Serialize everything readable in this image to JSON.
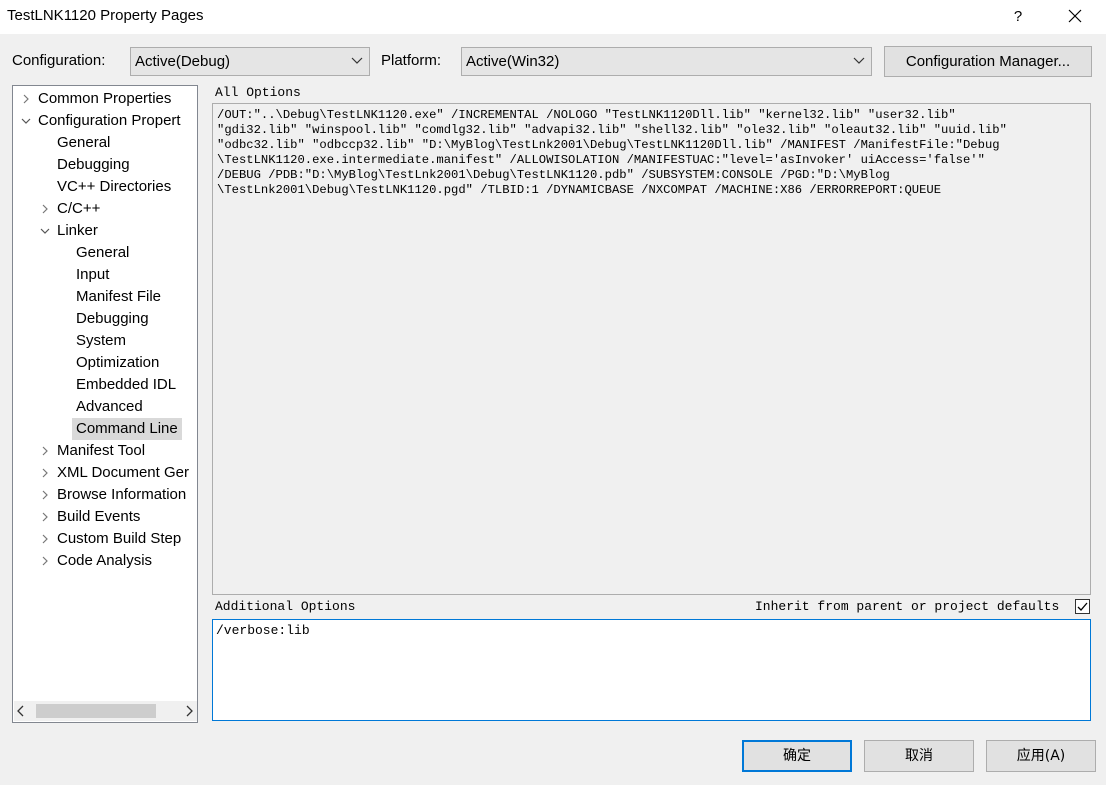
{
  "window": {
    "title": "TestLNK1120 Property Pages",
    "help_glyph": "?"
  },
  "config_bar": {
    "configuration_label": "Configuration:",
    "configuration_value": "Active(Debug)",
    "platform_label": "Platform:",
    "platform_value": "Active(Win32)",
    "manager_button": "Configuration Manager..."
  },
  "tree": {
    "items": [
      {
        "label": "Common Properties",
        "level": 0,
        "expander": "collapsed"
      },
      {
        "label": "Configuration Propert",
        "level": 0,
        "expander": "expanded"
      },
      {
        "label": "General",
        "level": 1,
        "expander": "none"
      },
      {
        "label": "Debugging",
        "level": 1,
        "expander": "none"
      },
      {
        "label": "VC++ Directories",
        "level": 1,
        "expander": "none"
      },
      {
        "label": "C/C++",
        "level": 1,
        "expander": "collapsed"
      },
      {
        "label": "Linker",
        "level": 1,
        "expander": "expanded"
      },
      {
        "label": "General",
        "level": 2,
        "expander": "none"
      },
      {
        "label": "Input",
        "level": 2,
        "expander": "none"
      },
      {
        "label": "Manifest File",
        "level": 2,
        "expander": "none"
      },
      {
        "label": "Debugging",
        "level": 2,
        "expander": "none"
      },
      {
        "label": "System",
        "level": 2,
        "expander": "none"
      },
      {
        "label": "Optimization",
        "level": 2,
        "expander": "none"
      },
      {
        "label": "Embedded IDL",
        "level": 2,
        "expander": "none"
      },
      {
        "label": "Advanced",
        "level": 2,
        "expander": "none"
      },
      {
        "label": "Command Line",
        "level": 2,
        "expander": "none",
        "selected": true
      },
      {
        "label": "Manifest Tool",
        "level": 1,
        "expander": "collapsed"
      },
      {
        "label": "XML Document Ger",
        "level": 1,
        "expander": "collapsed"
      },
      {
        "label": "Browse Information",
        "level": 1,
        "expander": "collapsed"
      },
      {
        "label": "Build Events",
        "level": 1,
        "expander": "collapsed"
      },
      {
        "label": "Custom Build Step",
        "level": 1,
        "expander": "collapsed"
      },
      {
        "label": "Code Analysis",
        "level": 1,
        "expander": "collapsed"
      }
    ]
  },
  "all_options": {
    "label": "All Options",
    "lines": [
      "/OUT:\"..\\Debug\\TestLNK1120.exe\" /INCREMENTAL /NOLOGO \"TestLNK1120Dll.lib\" \"kernel32.lib\" \"user32.lib\"",
      "\"gdi32.lib\" \"winspool.lib\" \"comdlg32.lib\" \"advapi32.lib\" \"shell32.lib\" \"ole32.lib\" \"oleaut32.lib\" \"uuid.lib\"",
      "\"odbc32.lib\" \"odbccp32.lib\" \"D:\\MyBlog\\TestLnk2001\\Debug\\TestLNK1120Dll.lib\" /MANIFEST /ManifestFile:\"Debug",
      "\\TestLNK1120.exe.intermediate.manifest\" /ALLOWISOLATION /MANIFESTUAC:\"level='asInvoker' uiAccess='false'\"",
      "/DEBUG /PDB:\"D:\\MyBlog\\TestLnk2001\\Debug\\TestLNK1120.pdb\" /SUBSYSTEM:CONSOLE /PGD:\"D:\\MyBlog",
      "\\TestLnk2001\\Debug\\TestLNK1120.pgd\" /TLBID:1 /DYNAMICBASE /NXCOMPAT /MACHINE:X86 /ERRORREPORT:QUEUE"
    ]
  },
  "additional_options": {
    "label": "Additional Options",
    "inherit_label": "Inherit from parent or project defaults",
    "inherit_checked": true,
    "value": "/verbose:lib"
  },
  "buttons": {
    "ok": "确定",
    "cancel": "取消",
    "apply": "应用(A)"
  }
}
